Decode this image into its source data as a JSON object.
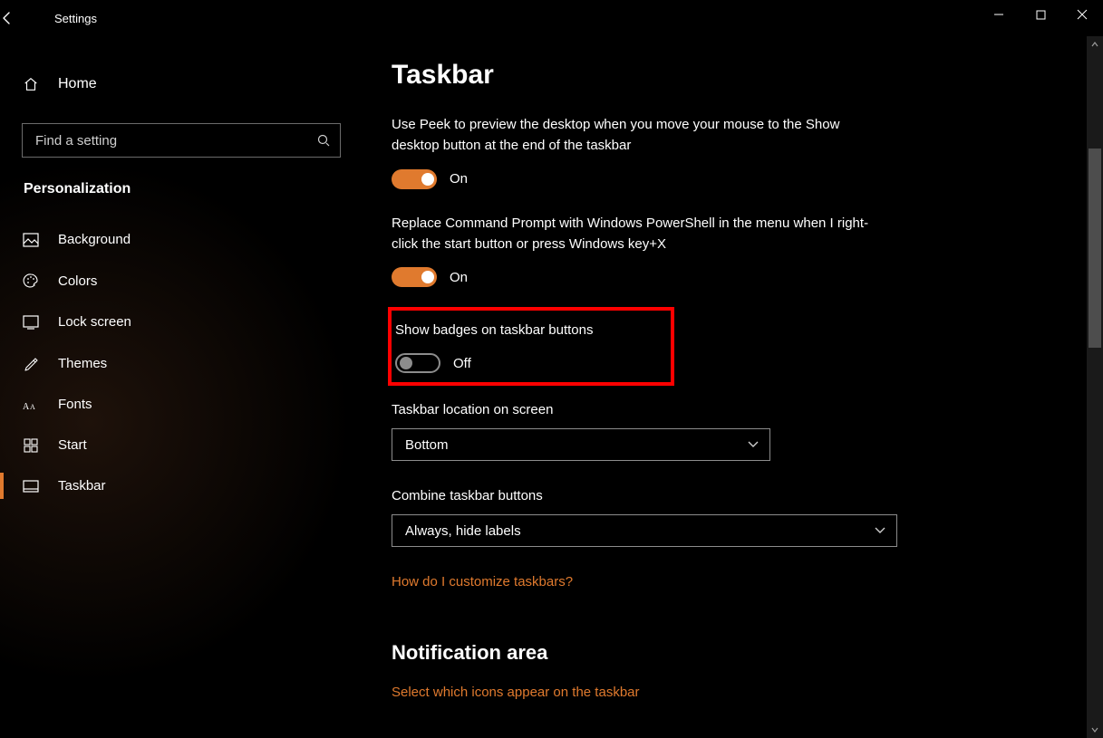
{
  "window": {
    "title": "Settings"
  },
  "sidebar": {
    "home": "Home",
    "search_placeholder": "Find a setting",
    "category": "Personalization",
    "items": [
      {
        "label": "Background"
      },
      {
        "label": "Colors"
      },
      {
        "label": "Lock screen"
      },
      {
        "label": "Themes"
      },
      {
        "label": "Fonts"
      },
      {
        "label": "Start"
      },
      {
        "label": "Taskbar"
      }
    ]
  },
  "page": {
    "title": "Taskbar",
    "peek_desc": "Use Peek to preview the desktop when you move your mouse to the Show desktop button at the end of the taskbar",
    "peek_state": "On",
    "powershell_desc": "Replace Command Prompt with Windows PowerShell in the menu when I right-click the start button or press Windows key+X",
    "powershell_state": "On",
    "badges_desc": "Show badges on taskbar buttons",
    "badges_state": "Off",
    "location_label": "Taskbar location on screen",
    "location_value": "Bottom",
    "combine_label": "Combine taskbar buttons",
    "combine_value": "Always, hide labels",
    "help_link": "How do I customize taskbars?",
    "notification_title": "Notification area",
    "notification_link": "Select which icons appear on the taskbar"
  }
}
